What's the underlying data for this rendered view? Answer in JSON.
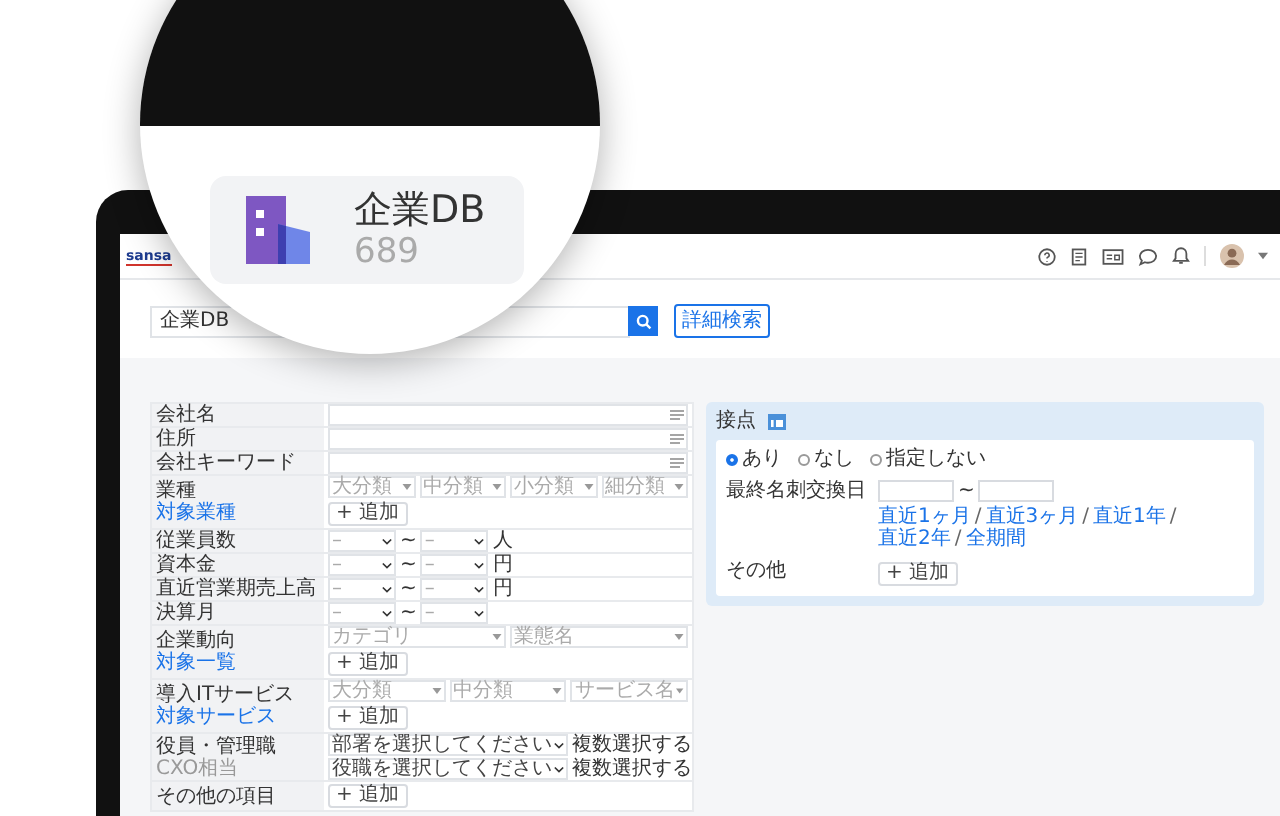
{
  "magnifier": {
    "title": "企業DB",
    "count": "689"
  },
  "header": {
    "logo": "sansa"
  },
  "search": {
    "value": "企業DB",
    "detail_button": "詳細検索"
  },
  "form": {
    "rows": [
      {
        "kind": "text",
        "label": "会社名"
      },
      {
        "kind": "text",
        "label": "住所"
      },
      {
        "kind": "text",
        "label": "会社キーワード"
      },
      {
        "kind": "category",
        "label": "業種",
        "link": "対象業種",
        "selects": [
          "大分類",
          "中分類",
          "小分類",
          "細分類"
        ],
        "add": "+ 追加"
      },
      {
        "kind": "range",
        "label": "従業員数",
        "from": "–",
        "sep": "~",
        "to": "–",
        "unit": "人"
      },
      {
        "kind": "range",
        "label": "資本金",
        "from": "–",
        "sep": "~",
        "to": "–",
        "unit": "円"
      },
      {
        "kind": "range",
        "label": "直近営業期売上高",
        "from": "–",
        "sep": "~",
        "to": "–",
        "unit": "円"
      },
      {
        "kind": "range",
        "label": "決算月",
        "from": "–",
        "sep": "~",
        "to": "–"
      },
      {
        "kind": "category",
        "label": "企業動向",
        "link": "対象一覧",
        "selects": [
          "カテゴリ",
          "業態名"
        ],
        "add": "+ 追加"
      },
      {
        "kind": "category",
        "label": "導入ITサービス",
        "link": "対象サービス",
        "selects": [
          "大分類",
          "中分類",
          "サービス名"
        ],
        "add": "+ 追加"
      },
      {
        "kind": "multi",
        "label": "役員・管理職",
        "sublabel": "CXO相当",
        "selects": [
          {
            "placeholder": "部署を選択してください",
            "note": "複数選択する"
          },
          {
            "placeholder": "役職を選択してください",
            "note": "複数選択する"
          }
        ]
      },
      {
        "kind": "add",
        "label": "その他の項目",
        "add": "+ 追加"
      }
    ]
  },
  "contact": {
    "title": "接点",
    "options": [
      {
        "label": "あり",
        "selected": true
      },
      {
        "label": "なし",
        "selected": false
      },
      {
        "label": "指定しない",
        "selected": false
      }
    ],
    "date_label": "最終名刺交換日",
    "date_sep": "~",
    "links": [
      "直近1ヶ月",
      "直近3ヶ月",
      "直近1年",
      "直近2年",
      "全期間"
    ],
    "link_sep": "/",
    "other_label": "その他",
    "add": "+ 追加"
  }
}
